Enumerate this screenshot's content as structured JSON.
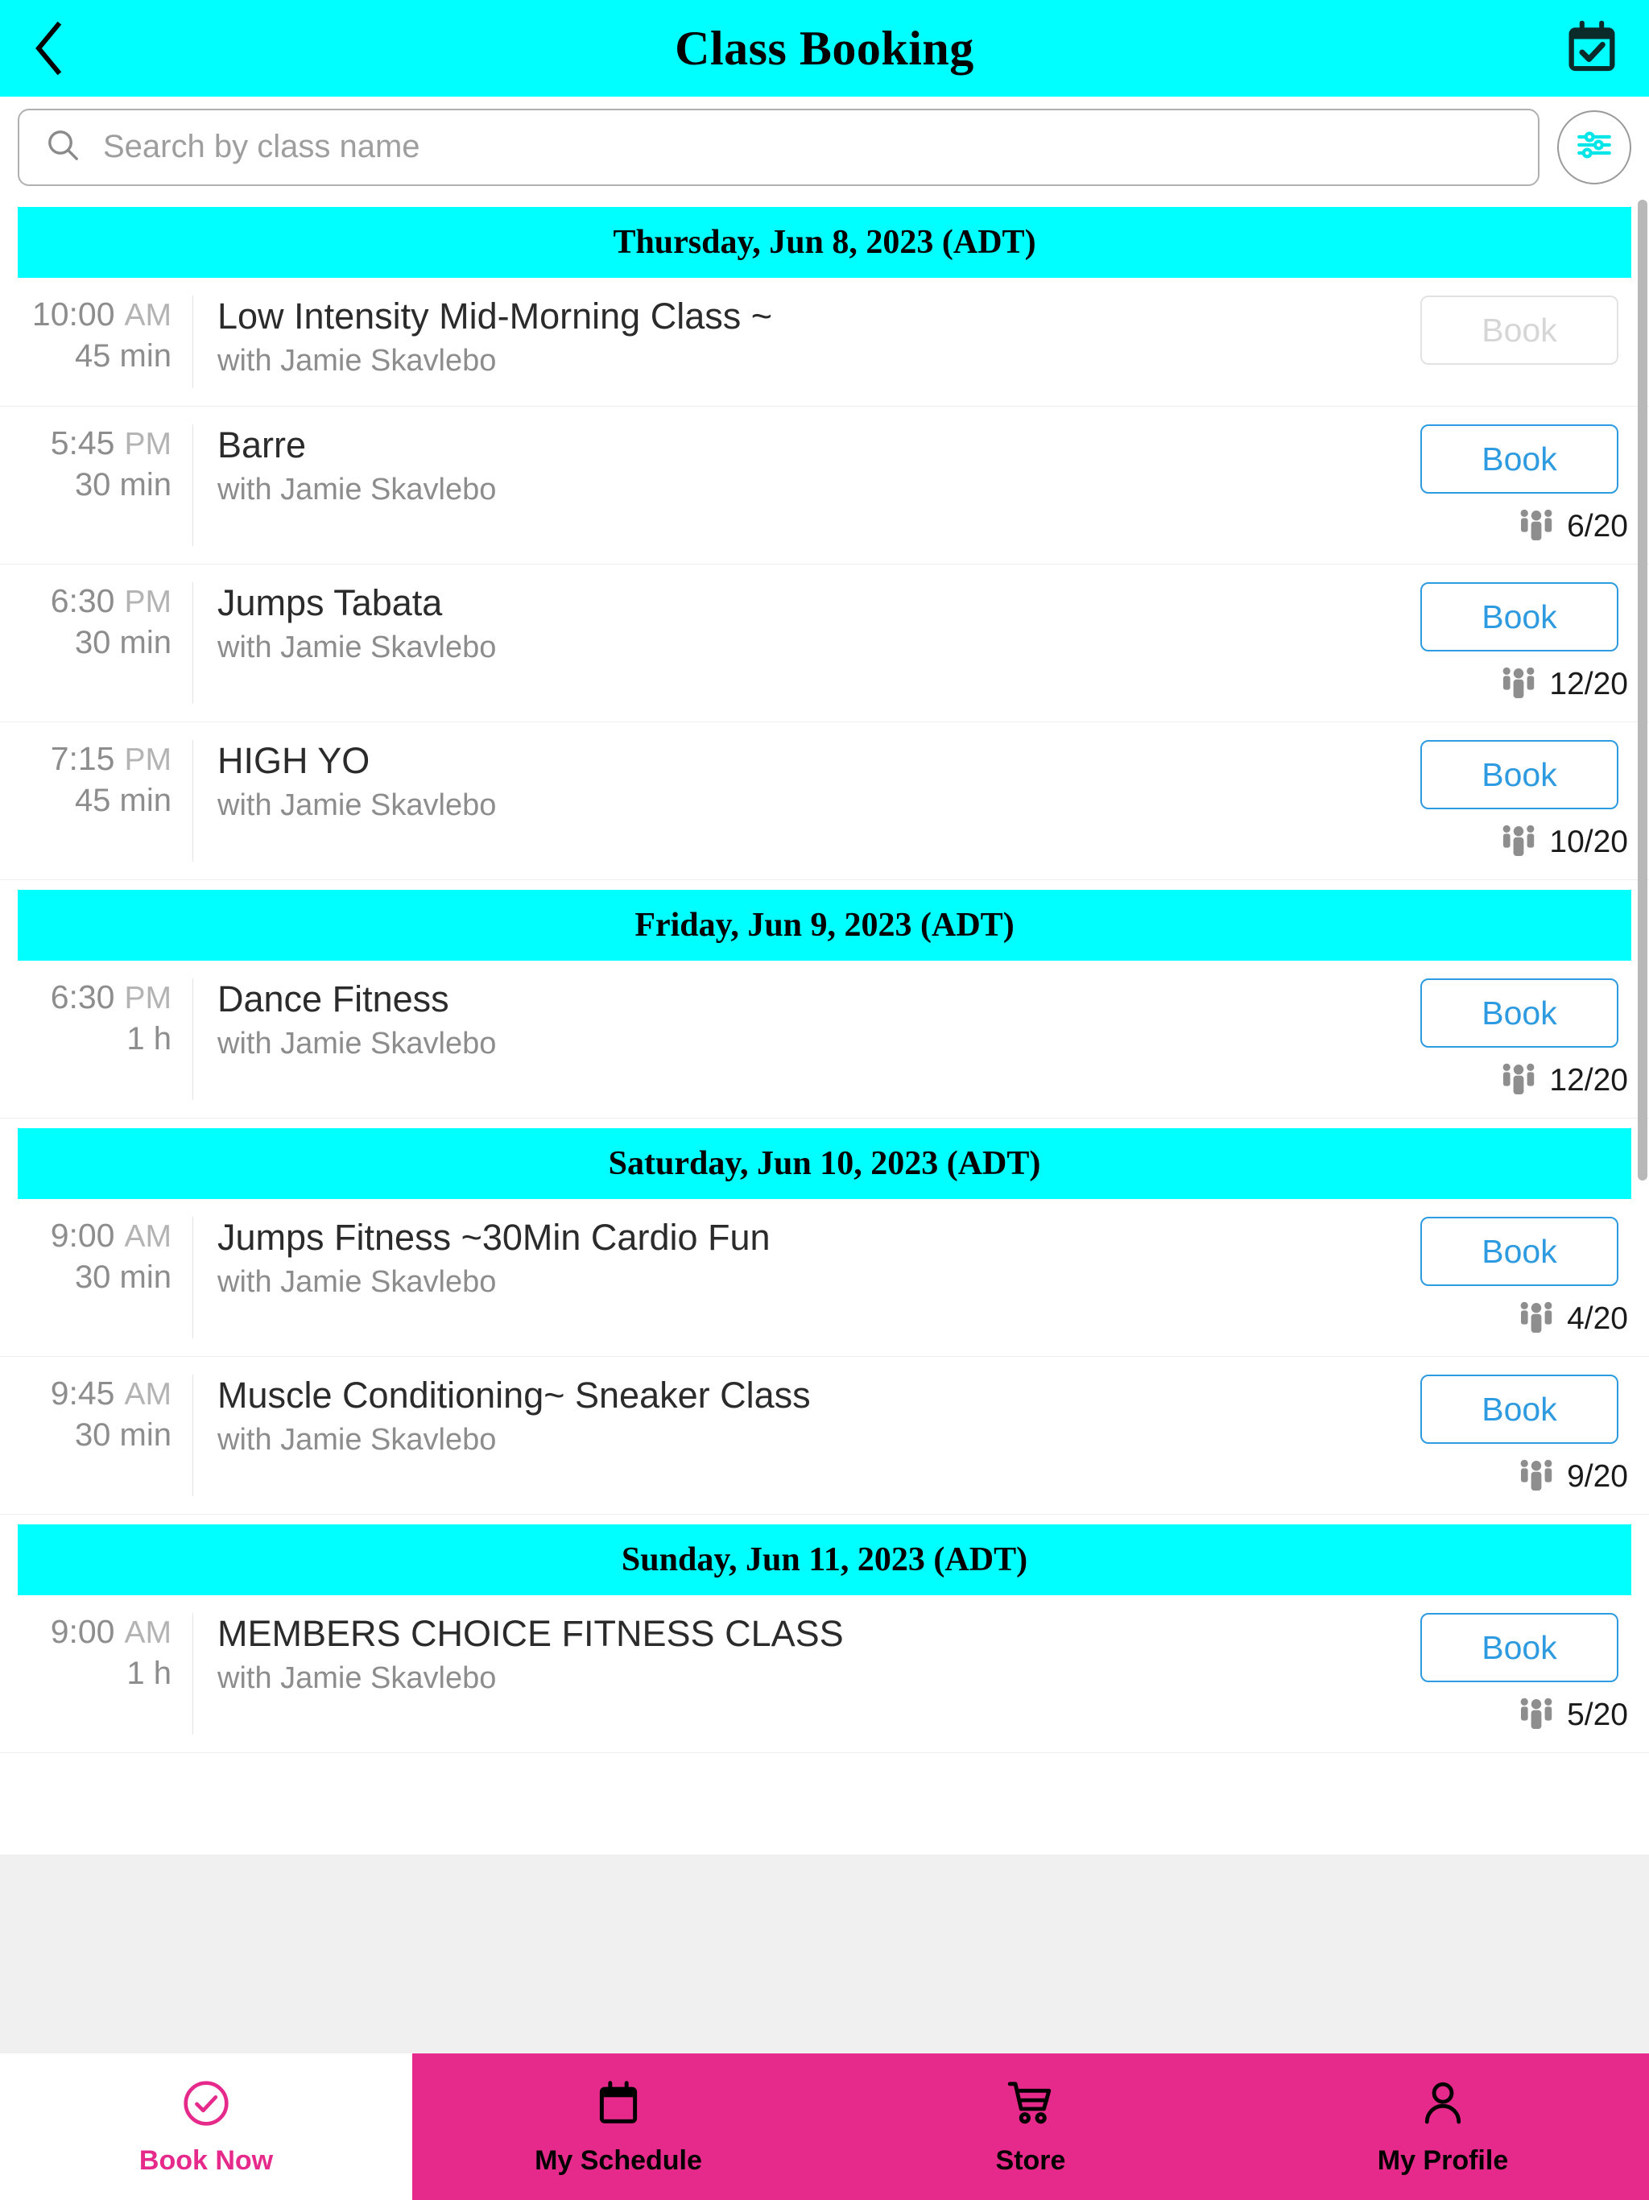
{
  "theme": {
    "accent_cyan": "#00FFFF",
    "accent_pink": "#E62A8B",
    "book_blue": "#2E9BE0",
    "disabled_grey": "#D6D6D6"
  },
  "header": {
    "title": "Class Booking",
    "back_icon": "chevron-left-icon",
    "calendar_icon": "calendar-check-icon"
  },
  "search": {
    "placeholder": "Search by class name",
    "value": "",
    "search_icon": "search-icon",
    "filter_icon": "sliders-filter-icon"
  },
  "instructor_prefix": "with",
  "book_label": "Book",
  "days": [
    {
      "date_label": "Thursday, Jun 8, 2023 (ADT)",
      "classes": [
        {
          "time": "10:00",
          "ampm": "AM",
          "duration": "45 min",
          "name": "Low Intensity Mid-Morning Class ~",
          "instructor": "with Jamie Skavlebo",
          "book_label": "Book",
          "disabled": true,
          "capacity": ""
        },
        {
          "time": "5:45",
          "ampm": "PM",
          "duration": "30 min",
          "name": "Barre",
          "instructor": "with Jamie Skavlebo",
          "book_label": "Book",
          "disabled": false,
          "capacity": "6/20"
        },
        {
          "time": "6:30",
          "ampm": "PM",
          "duration": "30 min",
          "name": "Jumps Tabata",
          "instructor": "with Jamie Skavlebo",
          "book_label": "Book",
          "disabled": false,
          "capacity": "12/20"
        },
        {
          "time": "7:15",
          "ampm": "PM",
          "duration": "45 min",
          "name": "HIGH YO",
          "instructor": "with Jamie Skavlebo",
          "book_label": "Book",
          "disabled": false,
          "capacity": "10/20"
        }
      ]
    },
    {
      "date_label": "Friday, Jun 9, 2023 (ADT)",
      "classes": [
        {
          "time": "6:30",
          "ampm": "PM",
          "duration": "1 h",
          "name": "Dance Fitness",
          "instructor": "with Jamie Skavlebo",
          "book_label": "Book",
          "disabled": false,
          "capacity": "12/20"
        }
      ]
    },
    {
      "date_label": "Saturday, Jun 10, 2023 (ADT)",
      "classes": [
        {
          "time": "9:00",
          "ampm": "AM",
          "duration": "30 min",
          "name": "Jumps Fitness ~30Min Cardio Fun",
          "instructor": "with Jamie Skavlebo",
          "book_label": "Book",
          "disabled": false,
          "capacity": "4/20"
        },
        {
          "time": "9:45",
          "ampm": "AM",
          "duration": "30 min",
          "name": "Muscle Conditioning~ Sneaker Class",
          "instructor": "with Jamie Skavlebo",
          "book_label": "Book",
          "disabled": false,
          "capacity": "9/20"
        }
      ]
    },
    {
      "date_label": "Sunday, Jun 11, 2023 (ADT)",
      "classes": [
        {
          "time": "9:00",
          "ampm": "AM",
          "duration": "1 h",
          "name": "MEMBERS CHOICE FITNESS CLASS",
          "instructor": "with Jamie Skavlebo",
          "book_label": "Book",
          "disabled": false,
          "capacity": "5/20"
        }
      ]
    }
  ],
  "bottom_nav": [
    {
      "label": "Book Now",
      "icon": "check-circle-icon",
      "active": true
    },
    {
      "label": "My Schedule",
      "icon": "calendar-icon",
      "active": false
    },
    {
      "label": "Store",
      "icon": "shopping-cart-icon",
      "active": false
    },
    {
      "label": "My Profile",
      "icon": "person-icon",
      "active": false
    }
  ]
}
